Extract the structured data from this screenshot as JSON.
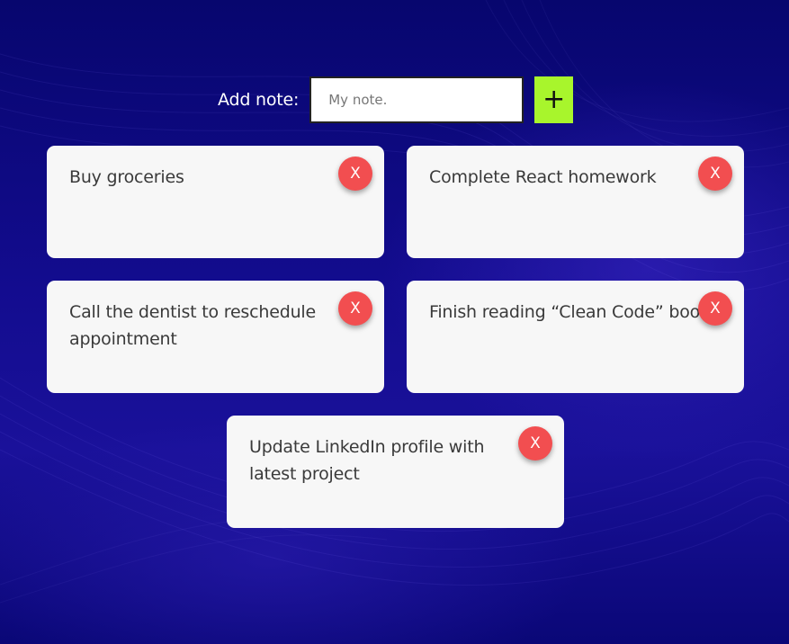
{
  "colors": {
    "background": "#0a0675",
    "add_button": "#a8f52c",
    "delete_button": "#f24e50",
    "card": "#f7f7f7"
  },
  "add_note": {
    "label": "Add note:",
    "input_value": "",
    "input_placeholder": "My note.",
    "button_label": "+",
    "button_icon": "plus-icon"
  },
  "notes": [
    {
      "text": "Buy groceries",
      "delete_label": "X"
    },
    {
      "text": "Complete React homework",
      "delete_label": "X"
    },
    {
      "text": "Call the dentist to reschedule appointment",
      "delete_label": "X"
    },
    {
      "text": "Finish reading “Clean Code” book",
      "delete_label": "X"
    },
    {
      "text": "Update LinkedIn profile with latest project",
      "delete_label": "X"
    }
  ]
}
